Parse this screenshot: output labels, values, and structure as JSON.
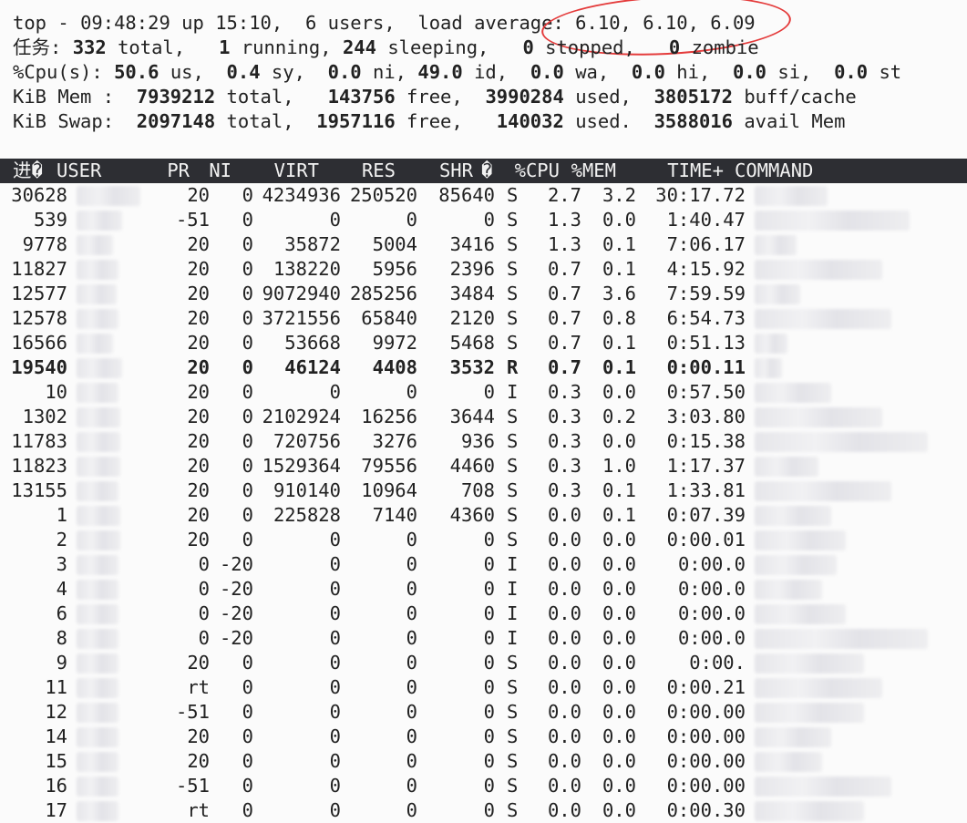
{
  "summary": {
    "top_prefix": "top - ",
    "time": "09:48:29",
    "uptime_label": " up ",
    "uptime": "15:10,",
    "users": "6 users,",
    "load_label": "load average:",
    "load_values": "6.10, 6.10, 6.09",
    "tasks_label": "任务:",
    "tasks_total": "332",
    "tasks_total_label": "total,",
    "tasks_running": "1",
    "tasks_running_label": "running,",
    "tasks_sleeping": "244",
    "tasks_sleeping_label": "sleeping,",
    "tasks_stopped": "0",
    "tasks_stopped_label": "stopped,",
    "tasks_zombie": "0",
    "tasks_zombie_label": "zombie",
    "cpu_label": "%Cpu(s):",
    "cpu_us": "50.6",
    "cpu_us_label": "us,",
    "cpu_sy": "0.4",
    "cpu_sy_label": "sy,",
    "cpu_ni": "0.0",
    "cpu_ni_label": "ni,",
    "cpu_id": "49.0",
    "cpu_id_label": "id,",
    "cpu_wa": "0.0",
    "cpu_wa_label": "wa,",
    "cpu_hi": "0.0",
    "cpu_hi_label": "hi,",
    "cpu_si": "0.0",
    "cpu_si_label": "si,",
    "cpu_st": "0.0",
    "cpu_st_label": "st",
    "mem_label": "KiB Mem :",
    "mem_total": "7939212",
    "mem_total_label": "total,",
    "mem_free": "143756",
    "mem_free_label": "free,",
    "mem_used": "3990284",
    "mem_used_label": "used,",
    "mem_cache": "3805172",
    "mem_cache_label": "buff/cache",
    "swap_label": "KiB Swap:",
    "swap_total": "2097148",
    "swap_total_label": "total,",
    "swap_free": "1957116",
    "swap_free_label": "free,",
    "swap_used": "140032",
    "swap_used_label": "used.",
    "swap_avail": "3588016",
    "swap_avail_label": "avail Mem"
  },
  "columns": {
    "pid": "进�",
    "user": "USER",
    "pr": "PR",
    "ni": "NI",
    "virt": "VIRT",
    "res": "RES",
    "shr": "SHR",
    "s": "�",
    "cpu": "%CPU",
    "mem": "%MEM",
    "time": "TIME+",
    "command": "COMMAND"
  },
  "annotation": {
    "color": "#e43b3b"
  },
  "processes": [
    {
      "pid": "30628",
      "pr": "20",
      "ni": "0",
      "virt": "4234936",
      "res": "250520",
      "shr": "85640",
      "s": "S",
      "cpu": "2.7",
      "mem": "3.2",
      "time": "30:17.72"
    },
    {
      "pid": "539",
      "pr": "-51",
      "ni": "0",
      "virt": "0",
      "res": "0",
      "shr": "0",
      "s": "S",
      "cpu": "1.3",
      "mem": "0.0",
      "time": "1:40.47"
    },
    {
      "pid": "9778",
      "pr": "20",
      "ni": "0",
      "virt": "35872",
      "res": "5004",
      "shr": "3416",
      "s": "S",
      "cpu": "1.3",
      "mem": "0.1",
      "time": "7:06.17"
    },
    {
      "pid": "11827",
      "pr": "20",
      "ni": "0",
      "virt": "138220",
      "res": "5956",
      "shr": "2396",
      "s": "S",
      "cpu": "0.7",
      "mem": "0.1",
      "time": "4:15.92"
    },
    {
      "pid": "12577",
      "pr": "20",
      "ni": "0",
      "virt": "9072940",
      "res": "285256",
      "shr": "3484",
      "s": "S",
      "cpu": "0.7",
      "mem": "3.6",
      "time": "7:59.59"
    },
    {
      "pid": "12578",
      "pr": "20",
      "ni": "0",
      "virt": "3721556",
      "res": "65840",
      "shr": "2120",
      "s": "S",
      "cpu": "0.7",
      "mem": "0.8",
      "time": "6:54.73"
    },
    {
      "pid": "16566",
      "pr": "20",
      "ni": "0",
      "virt": "53668",
      "res": "9972",
      "shr": "5468",
      "s": "S",
      "cpu": "0.7",
      "mem": "0.1",
      "time": "0:51.13"
    },
    {
      "pid": "19540",
      "pr": "20",
      "ni": "0",
      "virt": "46124",
      "res": "4408",
      "shr": "3532",
      "s": "R",
      "cpu": "0.7",
      "mem": "0.1",
      "time": "0:00.11",
      "bold": true
    },
    {
      "pid": "10",
      "pr": "20",
      "ni": "0",
      "virt": "0",
      "res": "0",
      "shr": "0",
      "s": "I",
      "cpu": "0.3",
      "mem": "0.0",
      "time": "0:57.50"
    },
    {
      "pid": "1302",
      "pr": "20",
      "ni": "0",
      "virt": "2102924",
      "res": "16256",
      "shr": "3644",
      "s": "S",
      "cpu": "0.3",
      "mem": "0.2",
      "time": "3:03.80"
    },
    {
      "pid": "11783",
      "pr": "20",
      "ni": "0",
      "virt": "720756",
      "res": "3276",
      "shr": "936",
      "s": "S",
      "cpu": "0.3",
      "mem": "0.0",
      "time": "0:15.38"
    },
    {
      "pid": "11823",
      "pr": "20",
      "ni": "0",
      "virt": "1529364",
      "res": "79556",
      "shr": "4460",
      "s": "S",
      "cpu": "0.3",
      "mem": "1.0",
      "time": "1:17.37"
    },
    {
      "pid": "13155",
      "pr": "20",
      "ni": "0",
      "virt": "910140",
      "res": "10964",
      "shr": "708",
      "s": "S",
      "cpu": "0.3",
      "mem": "0.1",
      "time": "1:33.81"
    },
    {
      "pid": "1",
      "pr": "20",
      "ni": "0",
      "virt": "225828",
      "res": "7140",
      "shr": "4360",
      "s": "S",
      "cpu": "0.0",
      "mem": "0.1",
      "time": "0:07.39"
    },
    {
      "pid": "2",
      "pr": "20",
      "ni": "0",
      "virt": "0",
      "res": "0",
      "shr": "0",
      "s": "S",
      "cpu": "0.0",
      "mem": "0.0",
      "time": "0:00.01"
    },
    {
      "pid": "3",
      "pr": "0",
      "ni": "-20",
      "virt": "0",
      "res": "0",
      "shr": "0",
      "s": "I",
      "cpu": "0.0",
      "mem": "0.0",
      "time": "0:00.0"
    },
    {
      "pid": "4",
      "pr": "0",
      "ni": "-20",
      "virt": "0",
      "res": "0",
      "shr": "0",
      "s": "I",
      "cpu": "0.0",
      "mem": "0.0",
      "time": "0:00.0"
    },
    {
      "pid": "6",
      "pr": "0",
      "ni": "-20",
      "virt": "0",
      "res": "0",
      "shr": "0",
      "s": "I",
      "cpu": "0.0",
      "mem": "0.0",
      "time": "0:00.0"
    },
    {
      "pid": "8",
      "pr": "0",
      "ni": "-20",
      "virt": "0",
      "res": "0",
      "shr": "0",
      "s": "I",
      "cpu": "0.0",
      "mem": "0.0",
      "time": "0:00.0"
    },
    {
      "pid": "9",
      "pr": "20",
      "ni": "0",
      "virt": "0",
      "res": "0",
      "shr": "0",
      "s": "S",
      "cpu": "0.0",
      "mem": "0.0",
      "time": "0:00."
    },
    {
      "pid": "11",
      "pr": "rt",
      "ni": "0",
      "virt": "0",
      "res": "0",
      "shr": "0",
      "s": "S",
      "cpu": "0.0",
      "mem": "0.0",
      "time": "0:00.21"
    },
    {
      "pid": "12",
      "pr": "-51",
      "ni": "0",
      "virt": "0",
      "res": "0",
      "shr": "0",
      "s": "S",
      "cpu": "0.0",
      "mem": "0.0",
      "time": "0:00.00"
    },
    {
      "pid": "14",
      "pr": "20",
      "ni": "0",
      "virt": "0",
      "res": "0",
      "shr": "0",
      "s": "S",
      "cpu": "0.0",
      "mem": "0.0",
      "time": "0:00.00"
    },
    {
      "pid": "15",
      "pr": "20",
      "ni": "0",
      "virt": "0",
      "res": "0",
      "shr": "0",
      "s": "S",
      "cpu": "0.0",
      "mem": "0.0",
      "time": "0:00.00"
    },
    {
      "pid": "16",
      "pr": "-51",
      "ni": "0",
      "virt": "0",
      "res": "0",
      "shr": "0",
      "s": "S",
      "cpu": "0.0",
      "mem": "0.0",
      "time": "0:00.00"
    },
    {
      "pid": "17",
      "pr": "rt",
      "ni": "0",
      "virt": "0",
      "res": "0",
      "shr": "0",
      "s": "S",
      "cpu": "0.0",
      "mem": "0.0",
      "time": "0:00.30"
    }
  ]
}
